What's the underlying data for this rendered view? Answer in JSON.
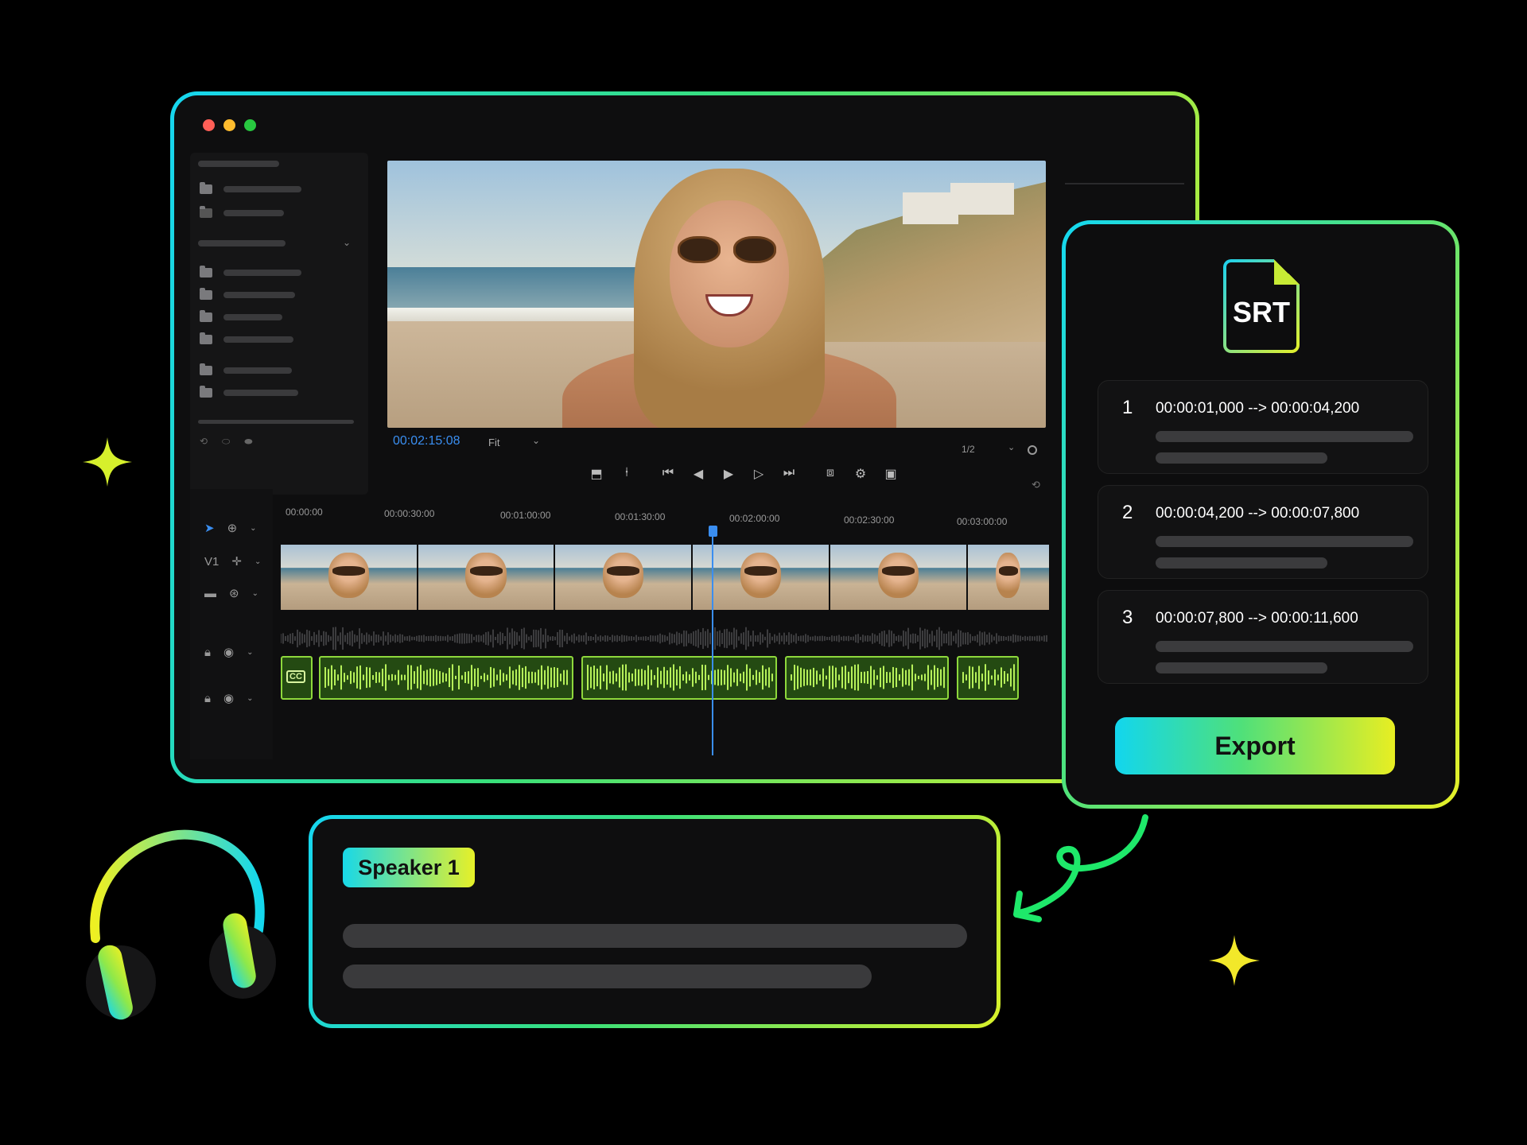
{
  "editor": {
    "preview": {
      "timecode": "00:02:15:08",
      "fit_label": "Fit",
      "ratio_label": "1/2"
    },
    "tracks": {
      "v1_label": "V1",
      "cc_label": "CC"
    },
    "ruler_ticks": [
      "00:00:00",
      "00:00:30:00",
      "00:01:00:00",
      "00:01:30:00",
      "00:02:00:00",
      "00:02:30:00",
      "00:03:00:00"
    ]
  },
  "srt_panel": {
    "file_label": "SRT",
    "entries": [
      {
        "index": "1",
        "time": "00:00:01,000 --> 00:00:04,200"
      },
      {
        "index": "2",
        "time": "00:00:04,200 --> 00:00:07,800"
      },
      {
        "index": "3",
        "time": "00:00:07,800 --> 00:00:11,600"
      }
    ],
    "export_label": "Export"
  },
  "speaker_panel": {
    "speaker_label": "Speaker 1"
  },
  "colors": {
    "accent_cyan": "#16d6f0",
    "accent_green": "#39e07a",
    "accent_yellow": "#d8f02a",
    "playhead_blue": "#3a8ef0",
    "subtitle_track_green": "#8ed83c"
  }
}
